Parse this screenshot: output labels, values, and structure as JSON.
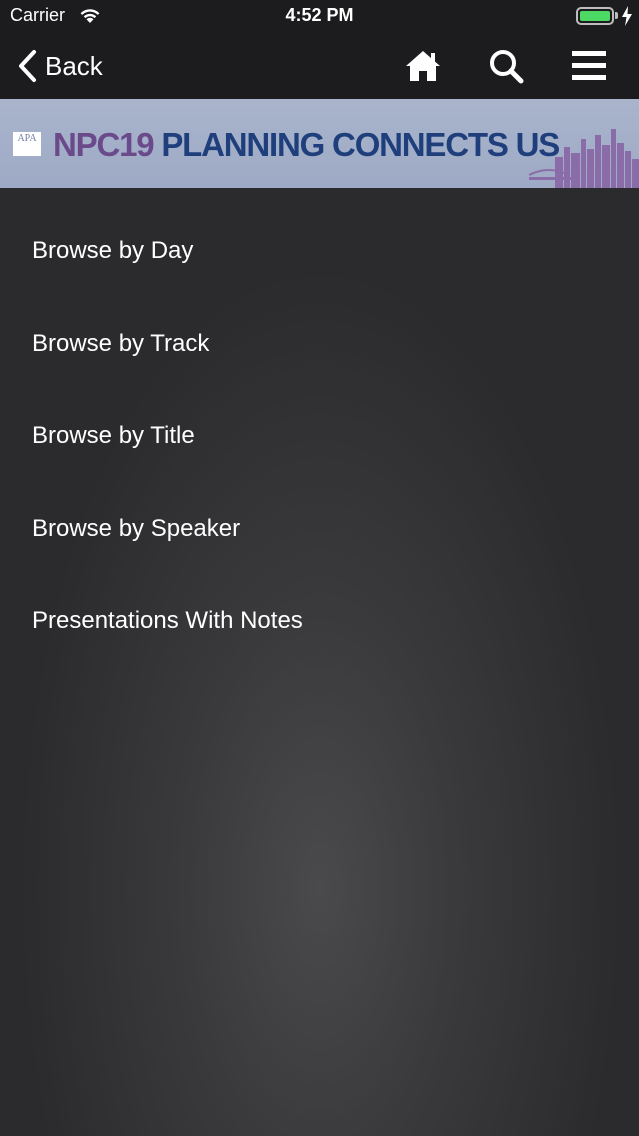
{
  "status_bar": {
    "carrier": "Carrier",
    "time": "4:52 PM",
    "battery_color": "#4cd964"
  },
  "nav_bar": {
    "back_label": "Back",
    "icons": [
      "home-icon",
      "search-icon",
      "hamburger-menu-icon"
    ]
  },
  "banner": {
    "logo_text": "APA",
    "npc": "NPC19",
    "tagline": "PLANNING CONNECTS US",
    "npc_color": "#6b4a8c",
    "tagline_color": "#1f3f7c"
  },
  "menu": {
    "items": [
      {
        "label": "Browse by Day"
      },
      {
        "label": "Browse by Track"
      },
      {
        "label": "Browse by Title"
      },
      {
        "label": "Browse by Speaker"
      },
      {
        "label": "Presentations With Notes"
      }
    ]
  }
}
